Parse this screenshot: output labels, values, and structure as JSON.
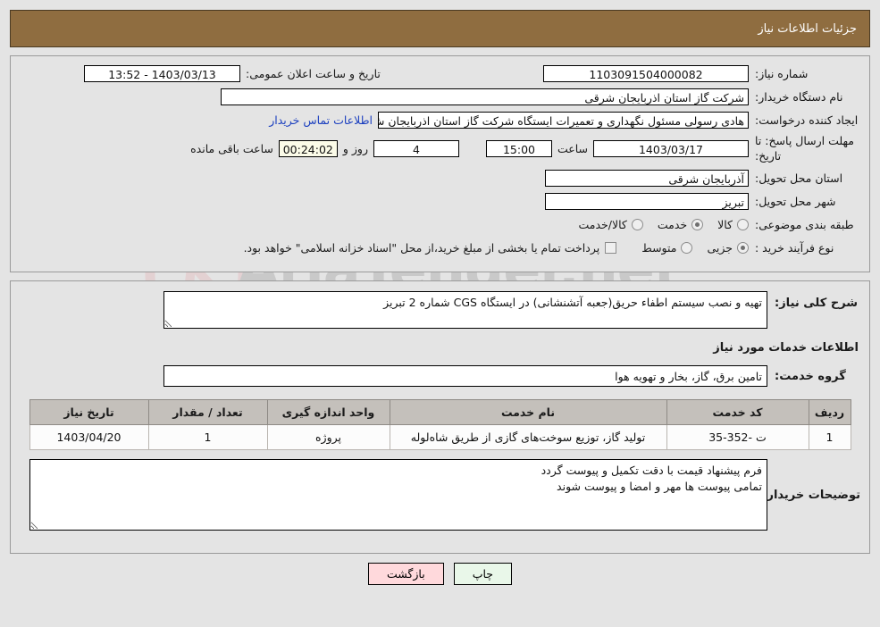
{
  "header": {
    "title": "جزئیات اطلاعات نیاز",
    "bar_color": "#8f6d40"
  },
  "watermark": {
    "text": "AriaTender.net"
  },
  "basic_info": {
    "need_number_label": "شماره نیاز:",
    "need_number_value": "1103091504000082",
    "announce_label": "تاریخ و ساعت اعلان عمومی:",
    "announce_value": "1403/03/13 - 13:52",
    "buyer_org_label": "نام دستگاه خریدار:",
    "buyer_org_value": "شرکت گاز استان اذربایجان شرقی",
    "creator_label": "ایجاد کننده درخواست:",
    "creator_value": "هادی رسولی مسئول نگهداری و تعمیرات ایستگاه شرکت گاز استان اذربایجان ش",
    "contact_link": "اطلاعات تماس خریدار",
    "deadline_label": "مهلت ارسال پاسخ: تا تاریخ:",
    "deadline_date": "1403/03/17",
    "hour_label": "ساعت",
    "deadline_time": "15:00",
    "days_value": "4",
    "days_label": "روز و",
    "countdown_value": "00:24:02",
    "countdown_label": "ساعت باقی مانده",
    "province_label": "استان محل تحویل:",
    "province_value": "آذربایجان شرقی",
    "city_label": "شهر محل تحویل:",
    "city_value": "تبریز",
    "category_label": "طبقه بندی موضوعی:",
    "category_options": [
      {
        "label": "کالا",
        "selected": false
      },
      {
        "label": "خدمت",
        "selected": true
      },
      {
        "label": "کالا/خدمت",
        "selected": false
      }
    ],
    "process_label": "نوع فرآیند خرید :",
    "process_options": [
      {
        "label": "جزیی",
        "selected": true
      },
      {
        "label": "متوسط",
        "selected": false
      }
    ],
    "treasury_checkbox_checked": false,
    "treasury_text": "پرداخت تمام یا بخشی از مبلغ خرید،از محل \"اسناد خزانه اسلامی\" خواهد بود."
  },
  "details": {
    "general_desc_label": "شرح کلی نیاز:",
    "general_desc_value": "تهیه و نصب سیستم اطفاء حریق(جعبه آتشنشانی) در ایستگاه CGS شماره 2 تبریز",
    "services_heading": "اطلاعات خدمات مورد نیاز",
    "service_group_label": "گروه خدمت:",
    "service_group_value": "تامین برق، گاز، بخار و تهویه هوا",
    "table": {
      "columns": [
        "ردیف",
        "کد خدمت",
        "نام خدمت",
        "واحد اندازه گیری",
        "تعداد / مقدار",
        "تاریخ نیاز"
      ],
      "rows": [
        {
          "row": "1",
          "code": "ت -352-35",
          "name": "تولید گاز، توزیع سوخت‌های گازی از طریق شاه‌لوله",
          "unit": "پروژه",
          "quantity": "1",
          "date": "1403/04/20"
        }
      ]
    },
    "buyer_notes_label": "توضیحات خریدار:",
    "buyer_notes_value": "فرم پیشنهاد قیمت با دقت تکمیل و پیوست گردد\nتمامی پیوست ها مهر و امضا و پیوست شوند"
  },
  "buttons": {
    "print": "چاپ",
    "back": "بازگشت"
  }
}
